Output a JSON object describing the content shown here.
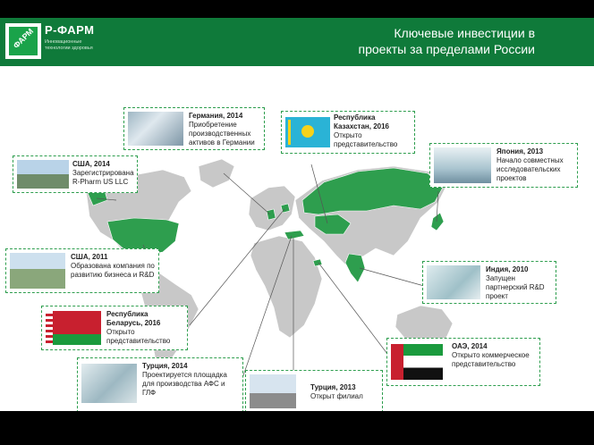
{
  "header": {
    "logo_name": "Р-ФАРМ",
    "logo_mark": "ФАРМ",
    "logo_slogan": "Инновационные технологии здоровья",
    "title_line1": "Ключевые инвестиции в",
    "title_line2": "проекты за пределами России"
  },
  "colors": {
    "brand_green": "#0f7a3a",
    "country_highlight": "#2e9e4e",
    "land": "#c8c8c8",
    "card_border": "#2e9e4e"
  },
  "cards": [
    {
      "id": "germany",
      "title": "Германия, 2014",
      "text": "Приобретение производственных активов в Германии",
      "image": "pharma-production-photo"
    },
    {
      "id": "kazakhstan",
      "title": "Республика Казахстан, 2016",
      "text": "Открыто представительство",
      "image": "kazakhstan-flag"
    },
    {
      "id": "japan",
      "title": "Япония, 2013",
      "text": "Начало совместных исследовательских проектов",
      "image": "laboratory-photo"
    },
    {
      "id": "usa2014",
      "title": "США, 2014",
      "text": "Зарегистрирована R-Pharm US LLC",
      "image": "office-building-photo"
    },
    {
      "id": "usa2011",
      "title": "США, 2011",
      "text": "Образована компания по развитию бизнеса и R&D",
      "image": "campus-photo"
    },
    {
      "id": "india",
      "title": "Индия, 2010",
      "text": "Запущен партнерский R&D проект",
      "image": "cleanroom-photo"
    },
    {
      "id": "belarus",
      "title": "Республика Беларусь, 2016",
      "text": "Открыто представительство",
      "image": "belarus-flag"
    },
    {
      "id": "uae",
      "title": "ОАЭ, 2014",
      "text": "Открыто коммерческое представительство",
      "image": "uae-flag"
    },
    {
      "id": "turkey2014",
      "title": "Турция, 2014",
      "text": "Проектируется площадка для производства АФС и ГЛФ",
      "image": "cleanroom-photo"
    },
    {
      "id": "turkey2013",
      "title": "Турция, 2013",
      "text": "Открыт филиал",
      "image": "modern-building-photo"
    }
  ]
}
